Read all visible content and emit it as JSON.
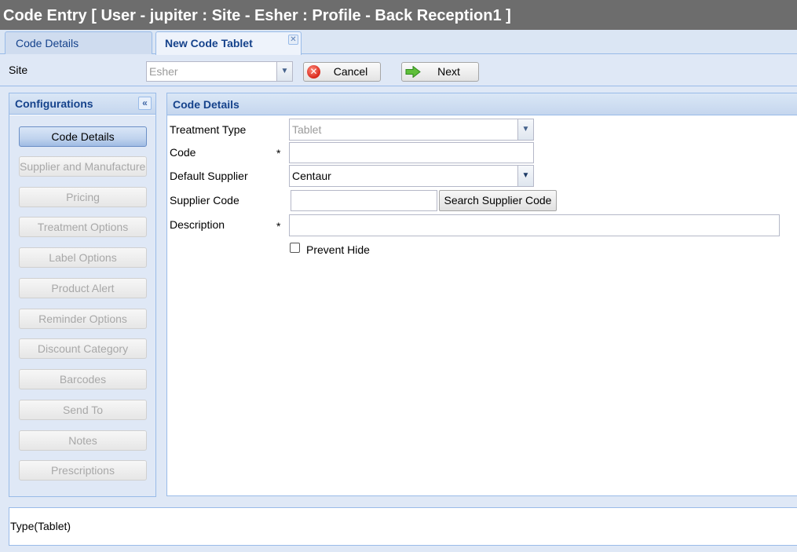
{
  "window": {
    "title": "Code Entry [ User - jupiter : Site - Esher : Profile - Back Reception1 ]"
  },
  "tabs": [
    {
      "label": "Code Details",
      "active": false
    },
    {
      "label": "New Code Tablet",
      "active": true,
      "closable": true
    }
  ],
  "toolbar": {
    "site_label": "Site",
    "site_value": "Esher",
    "cancel_label": "Cancel",
    "next_label": "Next"
  },
  "configurations": {
    "title": "Configurations",
    "items": [
      {
        "label": "Code Details",
        "active": true
      },
      {
        "label": "Supplier and Manufacturer",
        "active": false
      },
      {
        "label": "Pricing",
        "active": false
      },
      {
        "label": "Treatment Options",
        "active": false
      },
      {
        "label": "Label Options",
        "active": false
      },
      {
        "label": "Product Alert",
        "active": false
      },
      {
        "label": "Reminder Options",
        "active": false
      },
      {
        "label": "Discount Category",
        "active": false
      },
      {
        "label": "Barcodes",
        "active": false
      },
      {
        "label": "Send To",
        "active": false
      },
      {
        "label": "Notes",
        "active": false
      },
      {
        "label": "Prescriptions",
        "active": false
      }
    ]
  },
  "form": {
    "title": "Code Details",
    "treatment_type_label": "Treatment Type",
    "treatment_type_value": "Tablet",
    "code_label": "Code",
    "code_value": "",
    "default_supplier_label": "Default Supplier",
    "default_supplier_value": "Centaur",
    "supplier_code_label": "Supplier Code",
    "supplier_code_value": "",
    "search_supplier_code_label": "Search Supplier Code",
    "description_label": "Description",
    "description_value": "",
    "required_marker": "*",
    "prevent_hide_label": "Prevent Hide",
    "prevent_hide_checked": false
  },
  "status": {
    "text": "Type(Tablet)"
  },
  "colors": {
    "header_text": "#15428b",
    "panel_border": "#99bbe8",
    "title_bar": "#6d6d6d"
  }
}
